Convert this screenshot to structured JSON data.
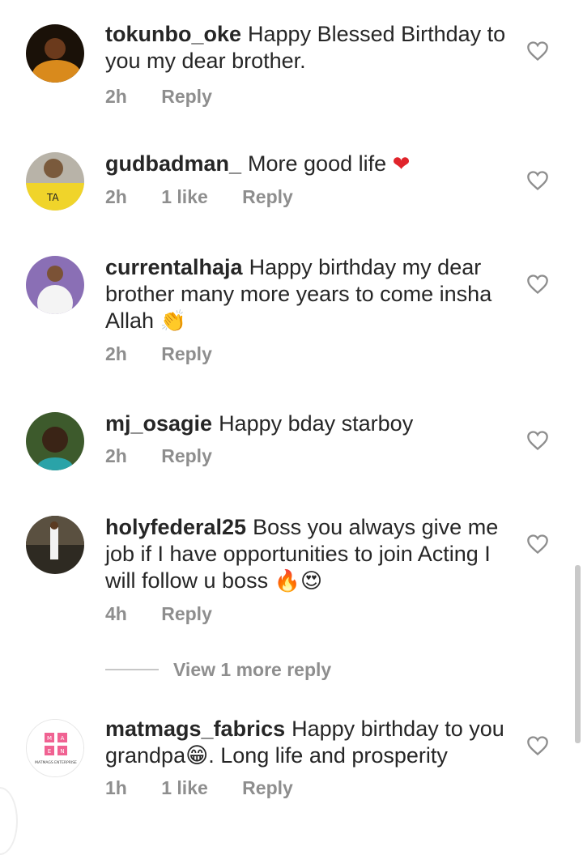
{
  "comments": [
    {
      "username": "tokunbo_oke",
      "text": "Happy Blessed Birthday to you my dear brother.",
      "emoji": "",
      "time": "2h",
      "likes": "",
      "reply": "Reply"
    },
    {
      "username": "gudbadman_",
      "text": "More good life",
      "emoji": "❤",
      "time": "2h",
      "likes": "1 like",
      "reply": "Reply"
    },
    {
      "username": "currentalhaja",
      "text": "Happy birthday my dear brother many more years to come insha Allah",
      "emoji": "👏",
      "time": "2h",
      "likes": "",
      "reply": "Reply"
    },
    {
      "username": "mj_osagie",
      "text": "Happy bday starboy",
      "emoji": "",
      "time": "2h",
      "likes": "",
      "reply": "Reply"
    },
    {
      "username": "holyfederal25",
      "text": "Boss you always give me job if I have opportunities to join Acting I will follow u boss",
      "emoji": "🔥😍",
      "time": "4h",
      "likes": "",
      "reply": "Reply"
    },
    {
      "username": "matmags_fabrics",
      "text": "Happy birthday to you grandpa😁. Long life and prosperity",
      "emoji": "",
      "time": "1h",
      "likes": "1 like",
      "reply": "Reply"
    }
  ],
  "view_more_replies": "View 1 more reply",
  "avatar_logo": {
    "letters": [
      "M",
      "A",
      "E",
      "N"
    ],
    "caption": "MATMAGS ENTERPRISE"
  },
  "colors": {
    "text": "#262626",
    "meta": "#8e8e8e",
    "heart": "#e0242b",
    "logo_pink": "#f06292"
  }
}
